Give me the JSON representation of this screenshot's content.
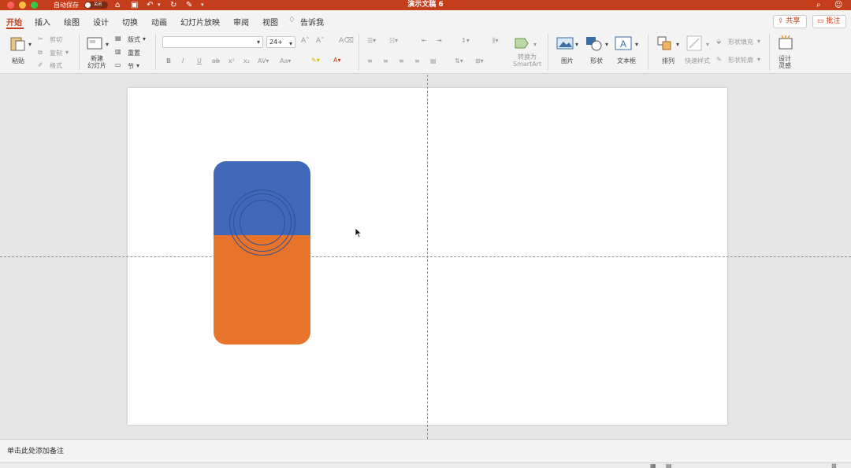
{
  "window": {
    "title": "演示文稿 6",
    "autosave_label": "自动保存",
    "autosave_state": "关闭"
  },
  "tabs": [
    {
      "label": "开始"
    },
    {
      "label": "插入"
    },
    {
      "label": "绘图"
    },
    {
      "label": "设计"
    },
    {
      "label": "切换"
    },
    {
      "label": "动画"
    },
    {
      "label": "幻灯片放映"
    },
    {
      "label": "审阅"
    },
    {
      "label": "视图"
    },
    {
      "label": "告诉我"
    }
  ],
  "header": {
    "share": "共享",
    "comment": "批注"
  },
  "ribbon": {
    "paste": "粘贴",
    "cut": "剪切",
    "copy": "复制",
    "format": "格式",
    "new_slide": "新建\n幻灯片",
    "layout": "版式",
    "reset": "重置",
    "section": "节",
    "font_name": "",
    "font_size": "24+",
    "convert_smartart": "转换为\nSmartArt",
    "picture": "图片",
    "shape": "形状",
    "textbox": "文本框",
    "arrange": "排列",
    "quick_styles": "快速样式",
    "shape_fill": "形状填充",
    "shape_outline": "形状轮廓",
    "design_ideas": "设计\n灵感"
  },
  "notes": {
    "placeholder": "单击此处添加备注"
  },
  "colors": {
    "accent": "#c43e1c",
    "shape_top": "#4068b8",
    "shape_bottom": "#e8732a"
  }
}
